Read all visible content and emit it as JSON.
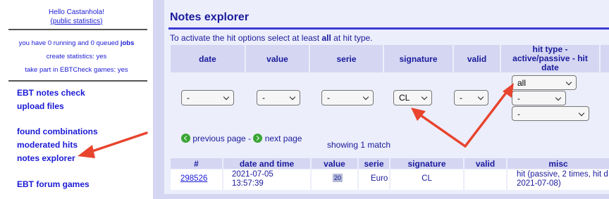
{
  "sidebar": {
    "hello": "Hello Castanhola!",
    "stats_link": "public statistics",
    "jobs_text": "you have 0 running and 0 queued",
    "jobs_link": "jobs",
    "create_stats": "create statistics: yes",
    "games": "take part in EBTCheck games: yes",
    "nav": {
      "notes_check": "EBT notes check",
      "upload": "upload files",
      "found": "found combinations",
      "moderated": "moderated hits",
      "explorer": "notes explorer",
      "forum": "EBT forum games"
    }
  },
  "main": {
    "title": "Notes explorer",
    "hint_before": "To activate the hit options select at least ",
    "hint_bold": "all",
    "hint_after": " at hit type.",
    "filter_headers": [
      "date",
      "value",
      "serie",
      "signature",
      "valid",
      "hit type - active/passive - hit date"
    ],
    "filters": {
      "date": "-",
      "value": "-",
      "serie": "-",
      "signature": "CL",
      "valid": "-",
      "hit_type": "all",
      "active_passive": "-",
      "hit_date": "-"
    },
    "pager": {
      "prev": "previous page",
      "sep": " - ",
      "next": "next page",
      "showing": "showing 1 match"
    },
    "results": {
      "headers": [
        "#",
        "date and time",
        "value",
        "serie",
        "signature",
        "valid",
        "misc"
      ],
      "rows": [
        {
          "id": "298526",
          "date": "2021-07-05",
          "time": "13:57:39",
          "value": "20",
          "serie": "Euro",
          "signature": "CL",
          "valid": "",
          "misc_line1": "hit (passive, 2 times, hit d",
          "misc_line2": "2021-07-08)"
        }
      ]
    }
  },
  "colors": {
    "link": "#1a1ad6",
    "header_bg": "#d4d6f2",
    "panel_bg": "#eceefb",
    "annotation_arrow": "#e8442e"
  }
}
